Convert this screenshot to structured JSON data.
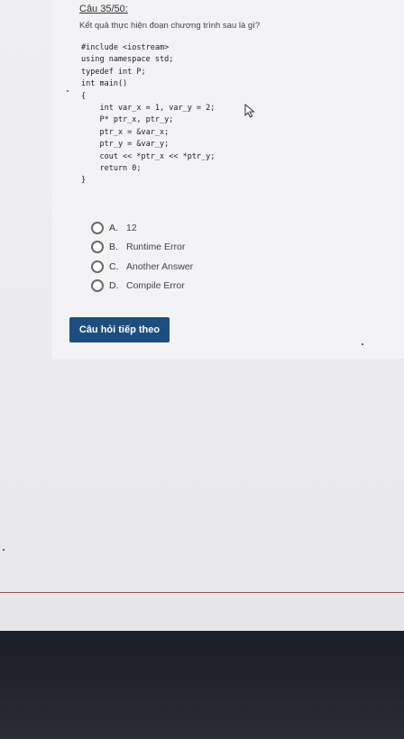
{
  "question": {
    "title": "Câu 35/50:",
    "text": "Kết quả thực hiện đoạn chương trình sau là gì?"
  },
  "code_lines": [
    "#include <iostream>",
    "using namespace std;",
    "typedef int P;",
    "int main()",
    "{",
    "    int var_x = 1, var_y = 2;",
    "    P* ptr_x, ptr_y;",
    "    ptr_x = &var_x;",
    "    ptr_y = &var_y;",
    "    cout << *ptr_x << *ptr_y;",
    "    return 0;",
    "}"
  ],
  "options": [
    {
      "letter": "A.",
      "text": "12"
    },
    {
      "letter": "B.",
      "text": "Runtime Error"
    },
    {
      "letter": "C.",
      "text": "Another Answer"
    },
    {
      "letter": "D.",
      "text": "Compile Error"
    }
  ],
  "next_button_label": "Câu hỏi tiếp theo",
  "colors": {
    "button_bg": "#1c4e80",
    "divider_red": "#c8433a"
  }
}
